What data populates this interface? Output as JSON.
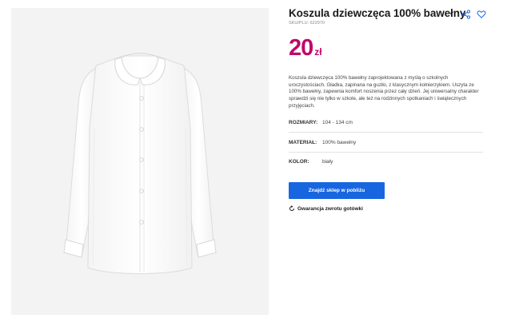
{
  "product": {
    "title": "Koszula dziewczęca 100% bawełny",
    "sku": "SKU/PLU: 622970",
    "price_amount": "20",
    "price_currency": "zł",
    "description": "Koszula dziewczęca 100% bawełny zaprojektowana z myślą o szkolnych uroczystościach. Gładka, zapinana na guziki, z klasycznym kołnierzykiem. Uszyta ze 100% bawełny, zapewnia komfort noszenia przez cały dzień. Jej uniwersalny charakter sprawdzi się nie tylko w szkole, ale też na rodzinnych spotkaniach i świątecznych przyjęciach.",
    "image_icon": "white-shirt-image"
  },
  "attributes": [
    {
      "key": "ROZMIARY:",
      "value": "104 - 134 cm"
    },
    {
      "key": "MATERIAŁ:",
      "value": "100% bawełny"
    },
    {
      "key": "KOLOR:",
      "value": "biały"
    }
  ],
  "actions": {
    "share_icon": "share-icon",
    "wishlist_icon": "heart-icon",
    "find_store_label": "Znajdź sklep w pobliżu",
    "guarantee_label": "Gwarancja zwrotu gotówki",
    "guarantee_icon": "refresh-icon"
  },
  "colors": {
    "price": "#c0076a",
    "cta_background": "#1766e0",
    "image_background": "#f3f3f3"
  }
}
